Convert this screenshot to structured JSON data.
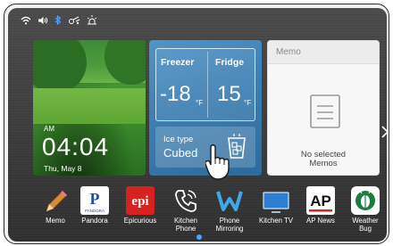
{
  "status_bar": {
    "icons": [
      "wifi-icon",
      "speaker-icon",
      "bluetooth-icon",
      "remote-icon",
      "sabbath-icon"
    ],
    "bluetooth_color": "#4a9fff"
  },
  "photo_widget": {
    "ampm": "AM",
    "time": "04:04",
    "date": "Thu, May 8"
  },
  "fridge_widget": {
    "freezer_label": "Freezer",
    "freezer_temp": "-18",
    "freezer_unit": "°F",
    "fridge_label": "Fridge",
    "fridge_temp": "15",
    "fridge_unit": "°F",
    "ice_type_label": "Ice type",
    "ice_type_value": "Cubed",
    "accent": "#3d7fb3"
  },
  "memo_widget": {
    "title": "Memo",
    "empty_line1": "No selected",
    "empty_line2": "Memos"
  },
  "dock": {
    "apps": [
      {
        "label": "Memo",
        "label2": "",
        "icon": "pencil-icon"
      },
      {
        "label": "Pandora",
        "label2": "",
        "icon": "pandora-icon",
        "icon_text": "P",
        "icon_sub": "PANDORA"
      },
      {
        "label": "Epicurious",
        "label2": "",
        "icon": "epicurious-icon",
        "icon_text": "epi"
      },
      {
        "label": "Kitchen",
        "label2": "Phone",
        "icon": "phone-icon"
      },
      {
        "label": "Phone",
        "label2": "Mirroring",
        "icon": "phone-mirroring-icon"
      },
      {
        "label": "Kitchen TV",
        "label2": "",
        "icon": "tv-icon"
      },
      {
        "label": "AP News",
        "label2": "",
        "icon": "ap-news-icon",
        "icon_text": "AP"
      },
      {
        "label": "Weather",
        "label2": "Bug",
        "icon": "weather-bug-icon"
      }
    ]
  },
  "pager": {
    "active_color": "#4aa3ff"
  }
}
